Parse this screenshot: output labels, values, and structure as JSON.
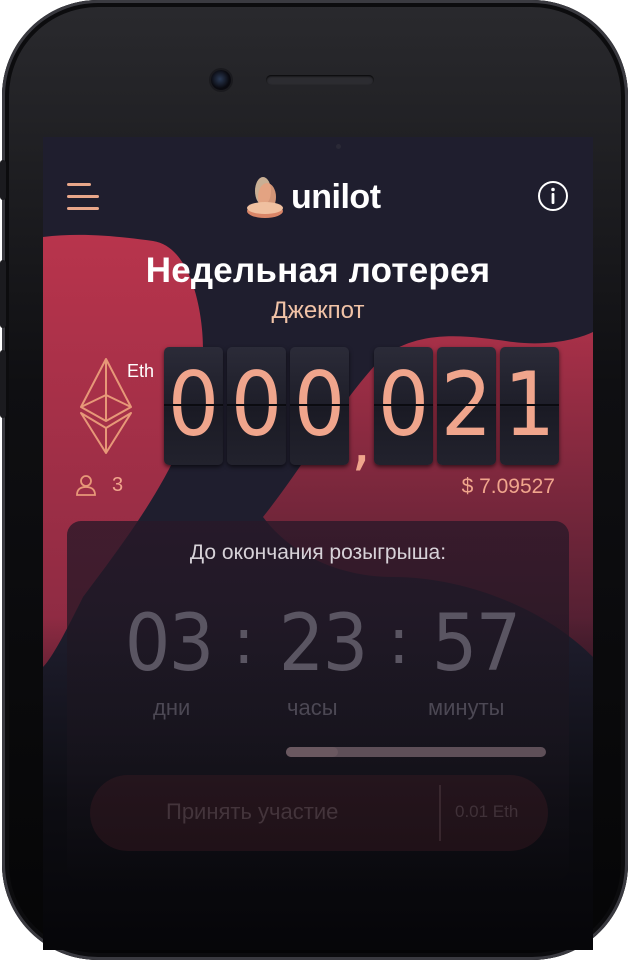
{
  "app": {
    "logo_text": "unilot",
    "menu_icon": "hamburger-menu-icon",
    "info_icon": "info-icon"
  },
  "lottery": {
    "title": "Недельная лотерея",
    "subtitle": "Джекпот",
    "currency": "Eth",
    "jackpot_digits": [
      "0",
      "0",
      "0",
      "0",
      "2",
      "1"
    ],
    "separator": ",",
    "players": "3",
    "usd_value": "$ 7.09527"
  },
  "timer": {
    "label": "До окончания розыгрыша:",
    "days": "03",
    "hours": "23",
    "minutes": "57",
    "colon": ":",
    "days_label": "дни",
    "hours_label": "часы",
    "minutes_label": "минуты",
    "progress_fraction": 0.2
  },
  "join": {
    "label": "Принять участие",
    "price": "0.01 Eth"
  },
  "colors": {
    "accent": "#f0a58c",
    "blob": "#b0334c",
    "background": "#1f1e2e"
  }
}
